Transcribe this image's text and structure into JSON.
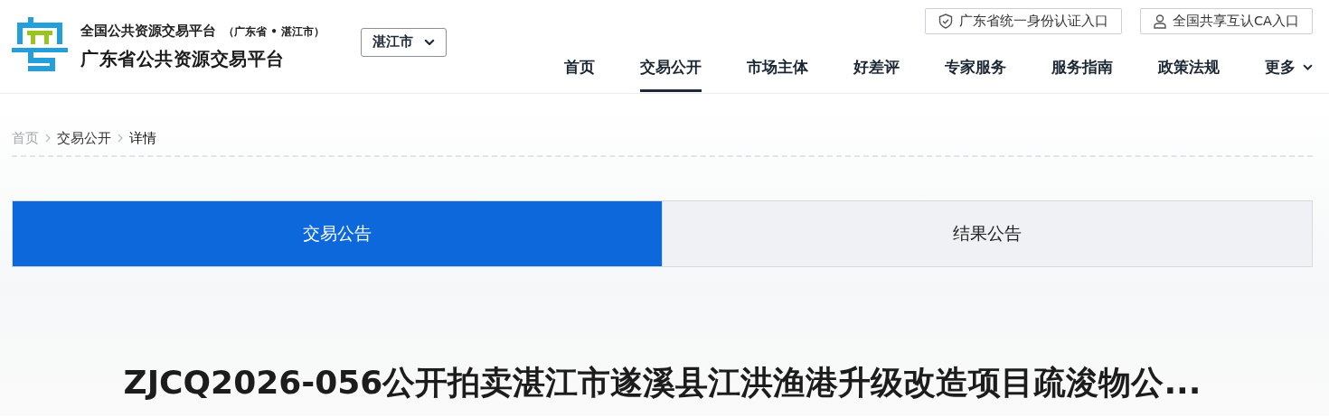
{
  "header": {
    "subtitle": "全国公共资源交易平台",
    "region_note": "（广东省 • 湛江市）",
    "title": "广东省公共资源交易平台",
    "city_select": "湛江市",
    "auth_links": [
      {
        "kind": "shield",
        "label": "广东省统一身份认证入口"
      },
      {
        "kind": "user",
        "label": "全国共享互认CA入口"
      }
    ],
    "nav": [
      {
        "label": "首页",
        "selected": false,
        "has_menu": false
      },
      {
        "label": "交易公开",
        "selected": true,
        "has_menu": false
      },
      {
        "label": "市场主体",
        "selected": false,
        "has_menu": false
      },
      {
        "label": "好差评",
        "selected": false,
        "has_menu": false
      },
      {
        "label": "专家服务",
        "selected": false,
        "has_menu": false
      },
      {
        "label": "服务指南",
        "selected": false,
        "has_menu": false
      },
      {
        "label": "政策法规",
        "selected": false,
        "has_menu": false
      },
      {
        "label": "更多",
        "selected": false,
        "has_menu": true
      }
    ]
  },
  "breadcrumb": [
    {
      "label": "首页"
    },
    {
      "label": "交易公开"
    },
    {
      "label": "详情"
    }
  ],
  "tabs": [
    {
      "label": "交易公告",
      "selected": true
    },
    {
      "label": "结果公告",
      "selected": false
    }
  ],
  "article_title": "ZJCQ2026-056公开拍卖湛江市遂溪县江洪渔港升级改造项目疏浚物公..."
}
